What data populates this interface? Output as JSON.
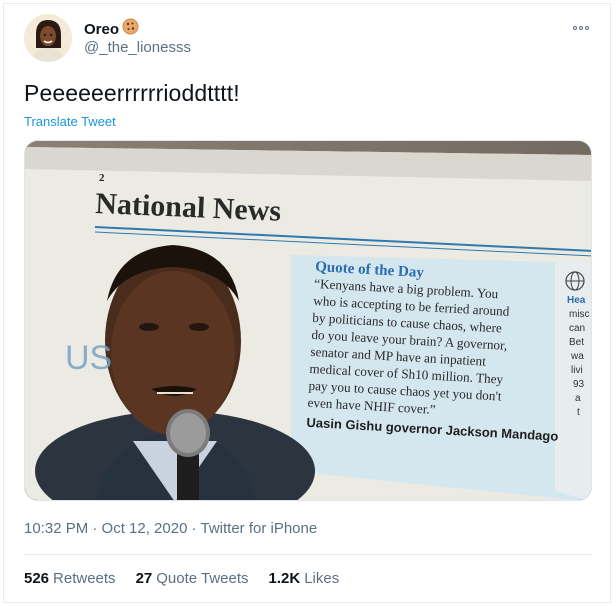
{
  "tweet": {
    "display_name": "Oreo",
    "name_emoji": "cookie-emoji",
    "handle": "@_the_lionesss",
    "text": "Peeeeeerrrrrrioddtttt!",
    "translate_label": "Translate Tweet",
    "timestamp": "10:32 PM · Oct 12, 2020 · Twitter for iPhone"
  },
  "photo": {
    "page_number": "2",
    "section_title": "National News",
    "faded_left": "US",
    "quote_heading": "Quote of the Day",
    "quote_lines": [
      "“Kenyans have a big problem. You",
      "who is accepting to be ferried around",
      "by politicians to cause chaos, where",
      "do you leave your brain? A governor,",
      "senator and MP have an inpatient",
      "medical cover of Sh10 million. They",
      "pay you to cause chaos yet you don't",
      "even have NHIF cover.”"
    ],
    "quote_attribution": "Uasin Gishu governor Jackson Mandago",
    "side_column": [
      "Hea",
      "misc",
      "can",
      "Bet",
      "wa",
      "livi",
      "93",
      "a",
      "t"
    ]
  },
  "stats": {
    "retweets_count": "526",
    "retweets_label": "Retweets",
    "quotes_count": "27",
    "quotes_label": "Quote Tweets",
    "likes_count": "1.2K",
    "likes_label": "Likes"
  },
  "colors": {
    "link": "#1b95e0",
    "secondary_text": "#5b7083",
    "quote_blue": "#2b6cb0"
  }
}
